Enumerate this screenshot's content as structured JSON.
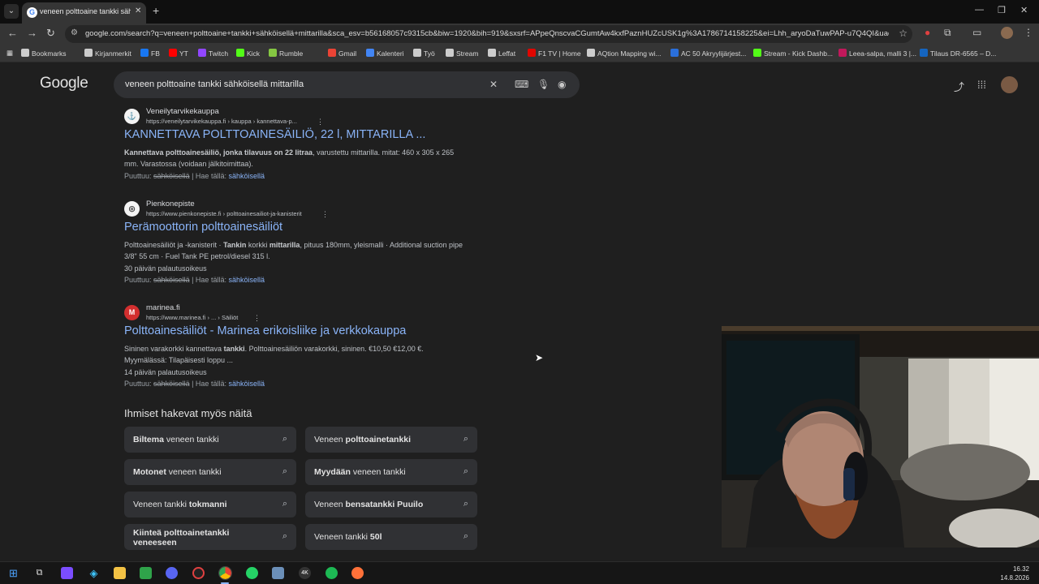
{
  "browser": {
    "tab_title": "veneen polttoaine tankki sähköis",
    "url": "google.com/search?q=veneen+polttoaine+tankki+sähköisellä+mittarilla&sca_esv=b56168057c9315cb&biw=1920&bih=919&sxsrf=APpeQnscvaCGumtAw4kxfPaznHUZcUSK1g%3A1786714158225&ei=Lhh_aryoDaTuwPAP-u7Q4QI&uact=5..."
  },
  "bookmarks": [
    {
      "label": "Bookmarks",
      "icon": "star-icon",
      "color": "#cccccc"
    },
    {
      "label": "Kirjanmerkit",
      "icon": "folder-icon",
      "color": "#cccccc"
    },
    {
      "label": "FB",
      "icon": "facebook-icon",
      "color": "#1877f2"
    },
    {
      "label": "YT",
      "icon": "youtube-icon",
      "color": "#ff0000"
    },
    {
      "label": "Twitch",
      "icon": "twitch-icon",
      "color": "#9146ff"
    },
    {
      "label": "Kick",
      "icon": "kick-icon",
      "color": "#53fc18"
    },
    {
      "label": "Rumble",
      "icon": "rumble-icon",
      "color": "#85c742"
    },
    {
      "label": "Gmail",
      "icon": "gmail-icon",
      "color": "#ea4335"
    },
    {
      "label": "Kalenteri",
      "icon": "calendar-icon",
      "color": "#4285f4"
    },
    {
      "label": "Työ",
      "icon": "folder-icon",
      "color": "#cccccc"
    },
    {
      "label": "Stream",
      "icon": "folder-icon",
      "color": "#cccccc"
    },
    {
      "label": "Leffat",
      "icon": "folder-icon",
      "color": "#cccccc"
    },
    {
      "label": "F1 TV | Home",
      "icon": "f1-icon",
      "color": "#e10600"
    },
    {
      "label": "AQtion Mapping wi...",
      "icon": "globe-icon",
      "color": "#cccccc"
    },
    {
      "label": "AC 50 Akryylijärjest...",
      "icon": "ac-icon",
      "color": "#2a6fdb"
    },
    {
      "label": "Stream - Kick Dashb...",
      "icon": "kick-icon",
      "color": "#53fc18"
    },
    {
      "label": "Leea-salpa, malli 3 |...",
      "icon": "shop-icon",
      "color": "#c2185b"
    },
    {
      "label": "Tilaus DR-6565 – D...",
      "icon": "order-icon",
      "color": "#1565c0"
    }
  ],
  "search": {
    "query": "veneen polttoaine tankki sähköisellä mittarilla"
  },
  "results": [
    {
      "site": "Veneilytarvikekauppa",
      "url": "https://veneilytarvikekauppa.fi › kauppa › kannettava-p...",
      "title": "KANNETTAVA POLTTOAINESÄILIÖ, 22 l, MITTARILLA ...",
      "snippet1_bold": "Kannettava polttoainesäiliö, jonka tilavuus on 22 litraa",
      "snippet1_rest": ", varustettu mittarilla. mitat: 460 x 305 x 265",
      "snippet2": "mm. Varastossa (voidaan jälkitoimittaa).",
      "favicon_color": "#f4f4f4"
    },
    {
      "site": "Pienkonepiste",
      "url": "https://www.pienkonepiste.fi › polttoainesailiot-ja-kanisterit",
      "title": "Perämoottorin polttoainesäiliöt",
      "snippet1_a": "Polttoainesäiliöt ja -kanisterit · ",
      "snippet1_b1": "Tankin",
      "snippet1_c": " korkki ",
      "snippet1_b2": "mittarilla",
      "snippet1_d": ", pituus 180mm, yleismalli · Additional suction pipe",
      "snippet2": "3/8\" 55 cm · Fuel Tank PE petrol/diesel 315 l.",
      "snippet3": "30 päivän palautusoikeus",
      "favicon_color": "#f4f4f4"
    },
    {
      "site": "marinea.fi",
      "url": "https://www.marinea.fi › ... › Säiliöt",
      "title": "Polttoainesäiliöt - Marinea erikoisliike ja verkkokauppa",
      "snippet1_a": "Sininen varakorkki kannettava ",
      "snippet1_b": "tankki",
      "snippet1_c": ". Polttoainesäiliön varakorkki, sininen. €10,50 €12,00 €.",
      "snippet2": "Myymälässä: Tilapäisesti loppu ...",
      "snippet3": "14 päivän palautusoikeus",
      "favicon_color": "#d32f2f"
    }
  ],
  "missing": {
    "prefix": "Puuttuu:",
    "struck": "sähköisellä",
    "sep": "| Hae tällä:",
    "link": "sähköisellä"
  },
  "people_also_search": {
    "title": "Ihmiset hakevat myös näitä",
    "chips": [
      {
        "bold": "Biltema",
        "rest": " veneen tankki"
      },
      {
        "pre": "Veneen ",
        "bold": "polttoainetankki"
      },
      {
        "bold": "Motonet",
        "rest": " veneen tankki"
      },
      {
        "bold": "Myydään",
        "rest": " veneen tankki"
      },
      {
        "pre": "Veneen tankki ",
        "bold": "tokmanni"
      },
      {
        "pre": "Veneen ",
        "bold": "bensatankki Puuilo"
      },
      {
        "bold": "Kiinteä polttoainetankki",
        "bold2": "veneeseen"
      },
      {
        "pre": "Veneen tankki ",
        "bold": "50l"
      }
    ]
  },
  "taskbar": {
    "time": "16.32",
    "date": "14.8.2026"
  }
}
